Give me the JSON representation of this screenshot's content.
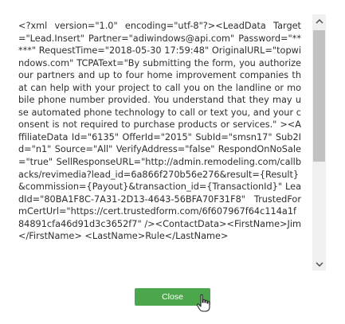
{
  "dialog": {
    "body_text": "<?xml version=\"1.0\" encoding=\"utf-8\"?><LeadData Target=\"Lead.Insert\" Partner=\"adiwindows@api.com\" Password=\"*****\" RequestTime=\"2018-05-30 17:59:48\" OriginalURL=\"topwindows.com\" TCPAText=\"By submitting the form, you authorize our partners and up to four home improvement companies that can help with your project to call you on the landline or mobile phone number provided. You understand that they may use automated phone technology to call or text you, and your consent is not required to purchase products or services.\" ><AffiliateData Id=\"6135\" OfferId=\"2015\" SubId=\"smsn17\" Sub2Id=\"n1\" Source=\"All\" VerifyAddress=\"false\" RespondOnNoSale=\"true\" SellResponseURL=\"http://admin.remodeling.com/callbacks/revimedia?lead_id=6a866f270b56e276&result={Result}&commission={Payout}&transaction_id={TransactionId}\" LeadId=\"80BA1F8C-7A31-2D13-4643-56BFA70F31F8\" TrustedFormCertUrl=\"https://cert.trustedform.com/6f607967f64c114a1f84891cfa46d91d3c3652f7\" /><ContactData><FirstName>Jim</FirstName> <LastName>Rule</LastName>",
    "close_label": "Close"
  },
  "scrollbar": {
    "up_icon": "chevron-up-icon",
    "down_icon": "chevron-down-icon"
  },
  "colors": {
    "button": "#4ca64c",
    "text": "#2e2e2e",
    "scroll_thumb": "#c1c1c1",
    "scroll_track": "#f0f0f0"
  }
}
